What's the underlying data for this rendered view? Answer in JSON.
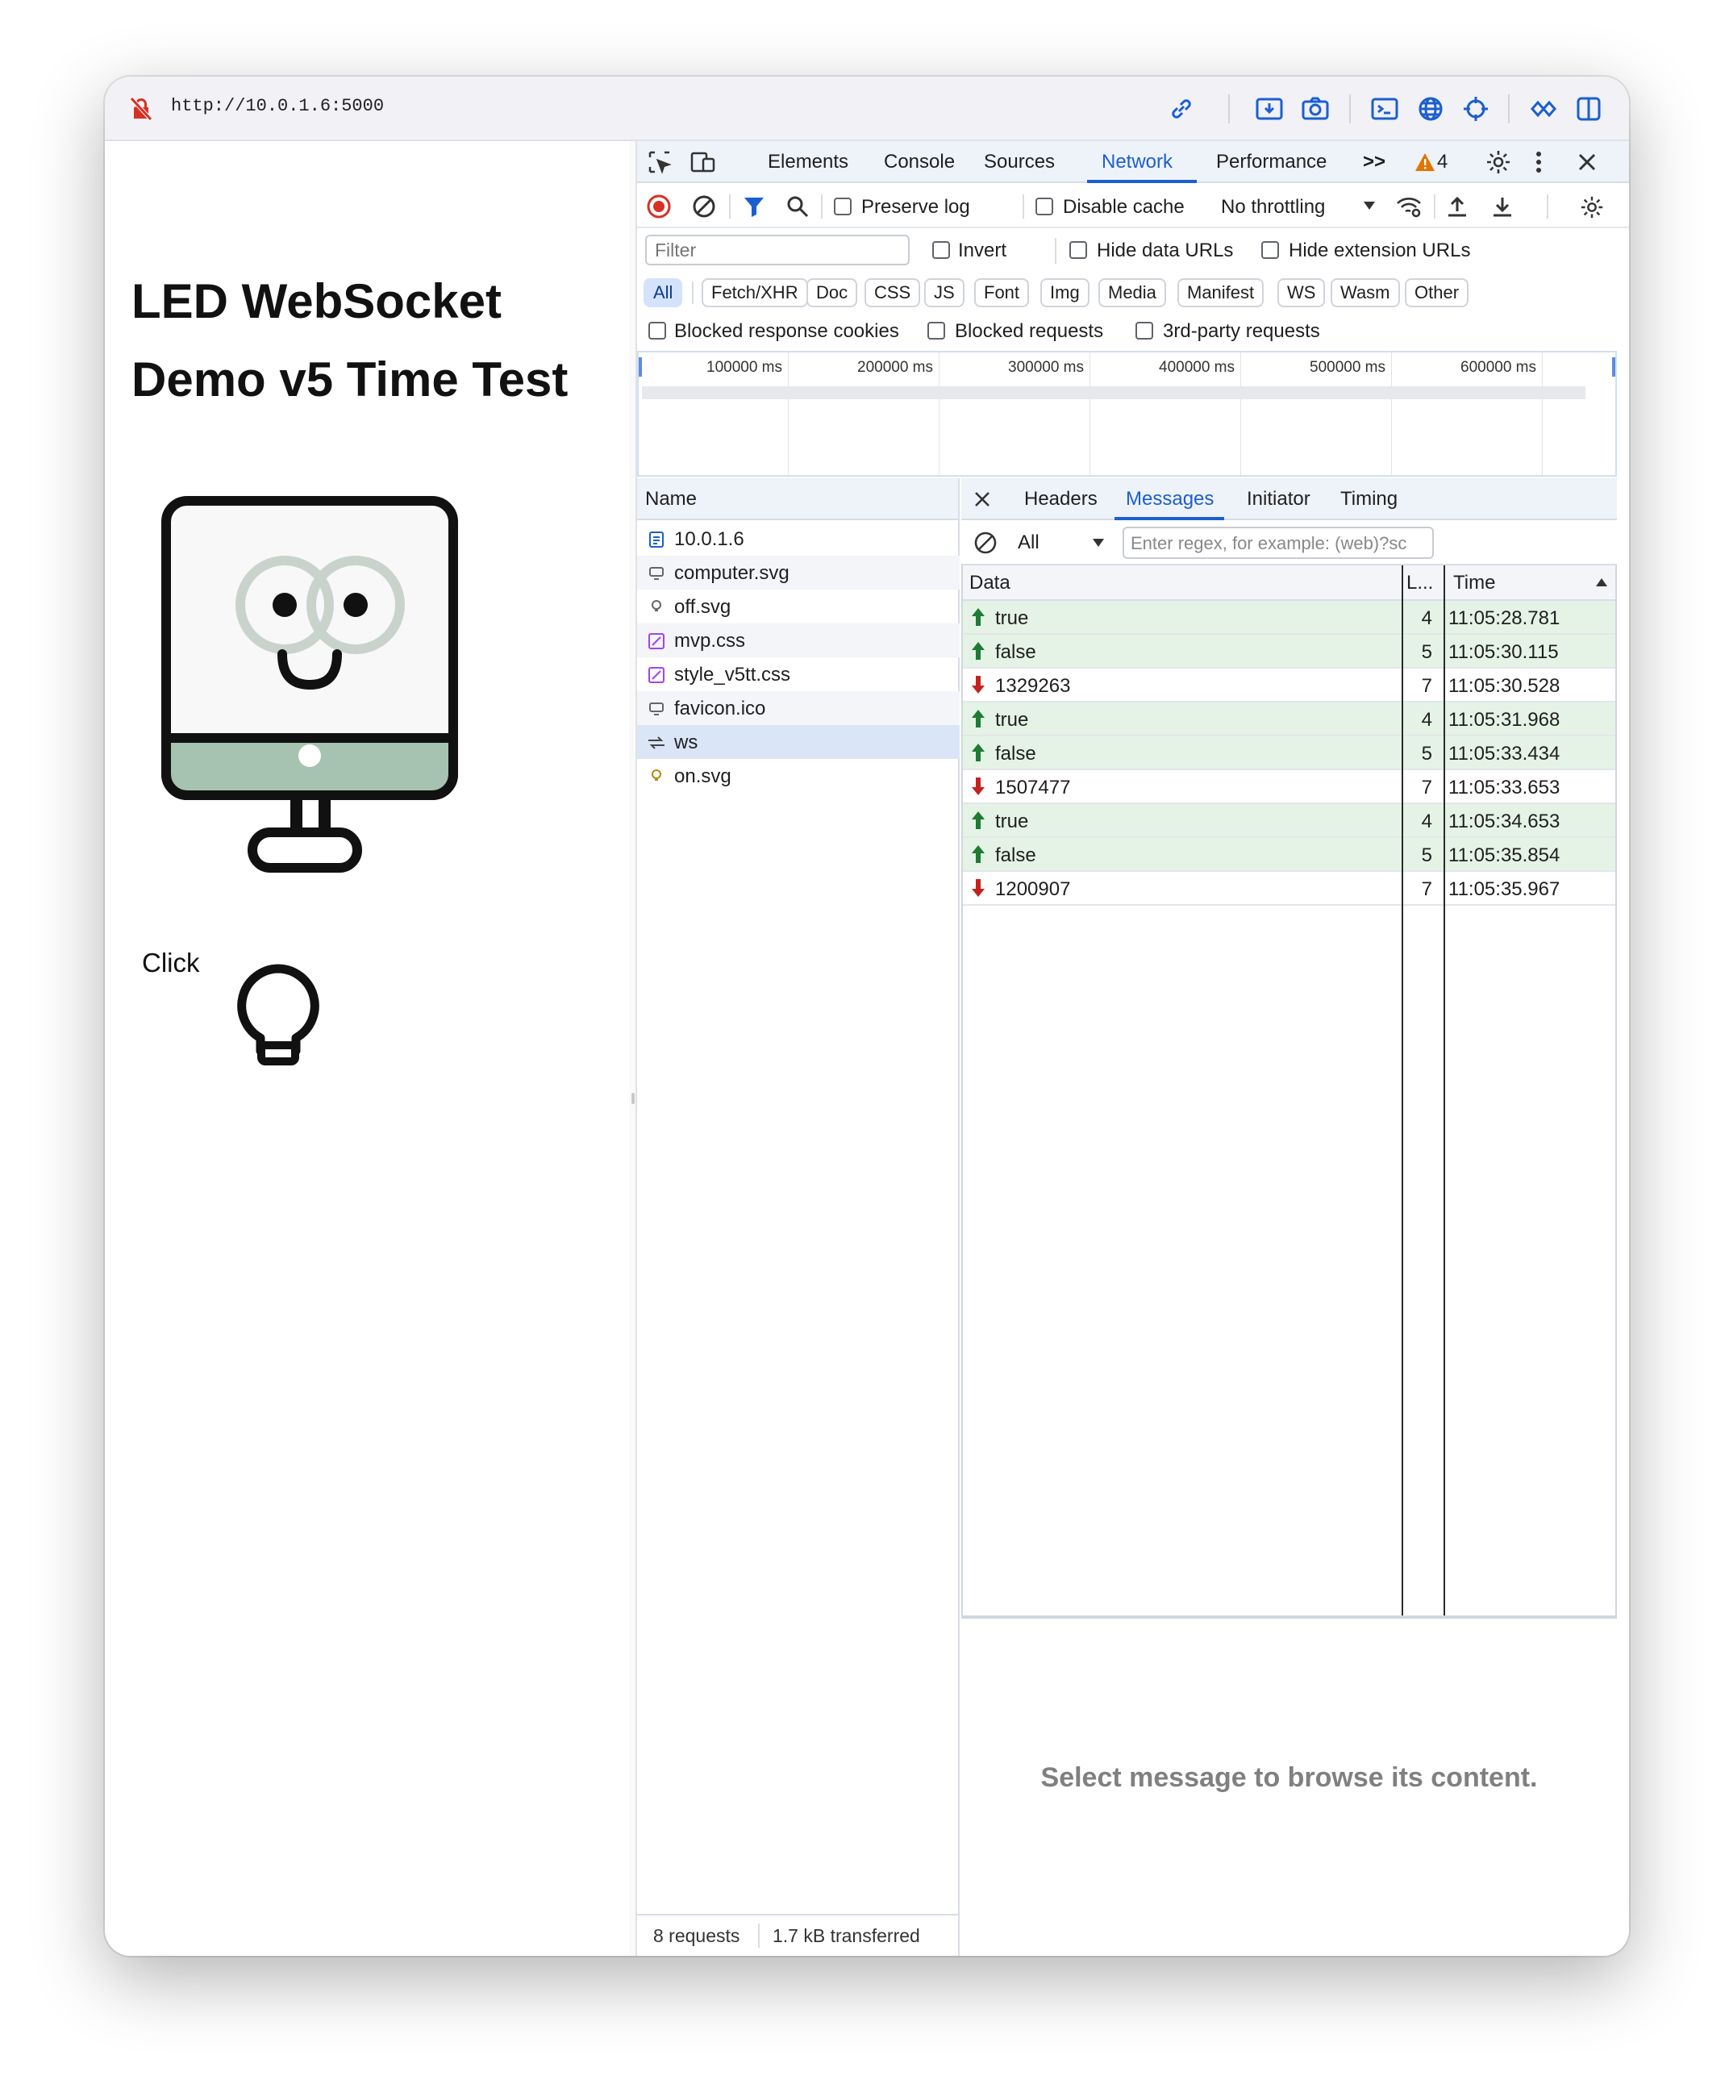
{
  "browser": {
    "url": "http://10.0.1.6:5000",
    "toolbar_icons": [
      "link-icon",
      "install-icon",
      "screenshot-icon",
      "terminal-icon",
      "globe-icon",
      "crosshair-icon",
      "extensions-icon",
      "sidebar-icon"
    ]
  },
  "page": {
    "title": "LED WebSocket Demo v5 Time Test",
    "click_label": "Click"
  },
  "devtools": {
    "tabs": [
      "Elements",
      "Console",
      "Sources",
      "Network",
      "Performance"
    ],
    "active_tab": "Network",
    "more_tabs_glyph": ">>",
    "warning_count": "4",
    "toolbar": {
      "preserve_log": "Preserve log",
      "disable_cache": "Disable cache",
      "throttling": "No throttling"
    },
    "filter": {
      "placeholder": "Filter",
      "invert": "Invert",
      "hide_data_urls": "Hide data URLs",
      "hide_extension_urls": "Hide extension URLs"
    },
    "type_filters": [
      "All",
      "Fetch/XHR",
      "Doc",
      "CSS",
      "JS",
      "Font",
      "Img",
      "Media",
      "Manifest",
      "WS",
      "Wasm",
      "Other"
    ],
    "active_type_filter": "All",
    "blocked": {
      "blocked_response_cookies": "Blocked response cookies",
      "blocked_requests": "Blocked requests",
      "third_party_requests": "3rd-party requests"
    },
    "overview_ticks": [
      "100000 ms",
      "200000 ms",
      "300000 ms",
      "400000 ms",
      "500000 ms",
      "600000 ms"
    ],
    "requests_header": "Name",
    "requests": [
      {
        "name": "10.0.1.6",
        "icon": "document-icon",
        "selected": false
      },
      {
        "name": "computer.svg",
        "icon": "image-icon",
        "selected": false
      },
      {
        "name": "off.svg",
        "icon": "bulb-small-icon",
        "selected": false
      },
      {
        "name": "mvp.css",
        "icon": "stylesheet-icon",
        "selected": false
      },
      {
        "name": "style_v5tt.css",
        "icon": "stylesheet-icon",
        "selected": false
      },
      {
        "name": "favicon.ico",
        "icon": "image-icon",
        "selected": false
      },
      {
        "name": "ws",
        "icon": "websocket-icon",
        "selected": true
      },
      {
        "name": "on.svg",
        "icon": "bulb-small-icon",
        "selected": false
      }
    ],
    "status": {
      "requests": "8 requests",
      "transferred": "1.7 kB transferred"
    },
    "detail_tabs": [
      "Headers",
      "Messages",
      "Initiator",
      "Timing"
    ],
    "active_detail_tab": "Messages",
    "message_filter": {
      "type": "All",
      "regex_placeholder": "Enter regex, for example: (web)?sc"
    },
    "message_columns": {
      "data": "Data",
      "length": "L...",
      "time": "Time"
    },
    "messages": [
      {
        "direction": "sent",
        "data": "true",
        "length": "4",
        "time": "11:05:28.781"
      },
      {
        "direction": "sent",
        "data": "false",
        "length": "5",
        "time": "11:05:30.115"
      },
      {
        "direction": "received",
        "data": "1329263",
        "length": "7",
        "time": "11:05:30.528"
      },
      {
        "direction": "sent",
        "data": "true",
        "length": "4",
        "time": "11:05:31.968"
      },
      {
        "direction": "sent",
        "data": "false",
        "length": "5",
        "time": "11:05:33.434"
      },
      {
        "direction": "received",
        "data": "1507477",
        "length": "7",
        "time": "11:05:33.653"
      },
      {
        "direction": "sent",
        "data": "true",
        "length": "4",
        "time": "11:05:34.653"
      },
      {
        "direction": "sent",
        "data": "false",
        "length": "5",
        "time": "11:05:35.854"
      },
      {
        "direction": "received",
        "data": "1200907",
        "length": "7",
        "time": "11:05:35.967"
      }
    ],
    "empty_message": "Select message to browse its content.",
    "colors": {
      "accent": "#1a5fd0",
      "sent_row": "#e4f3e5",
      "sent_arrow": "#1e7a35",
      "received_arrow": "#c5221f",
      "warning": "#e37400"
    }
  }
}
